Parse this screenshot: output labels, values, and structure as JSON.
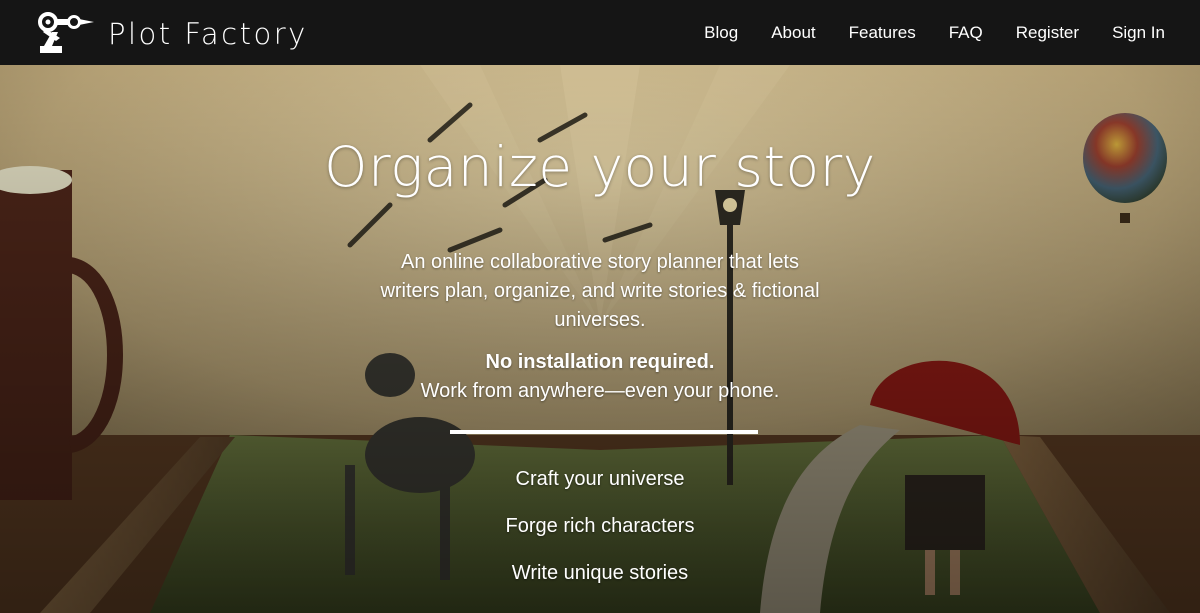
{
  "brand": {
    "name": "Plot Factory",
    "logo_icon": "robot-arm-pen-icon"
  },
  "nav": {
    "items": [
      {
        "label": "Blog"
      },
      {
        "label": "About"
      },
      {
        "label": "Features"
      },
      {
        "label": "FAQ"
      },
      {
        "label": "Register"
      },
      {
        "label": "Sign In"
      }
    ]
  },
  "hero": {
    "title": "Organize your story",
    "description": "An online collaborative story planner that lets writers plan, organize, and write stories & fictional universes.",
    "strong": "No installation required.",
    "sub": "Work from anywhere—even your phone.",
    "features": [
      {
        "label": "Craft your universe"
      },
      {
        "label": "Forge rich characters"
      },
      {
        "label": "Write unique stories"
      }
    ]
  },
  "colors": {
    "navbar": "#151515",
    "text": "#ffffff",
    "sky": "#c9b48a",
    "grass": "#5f6d36"
  }
}
